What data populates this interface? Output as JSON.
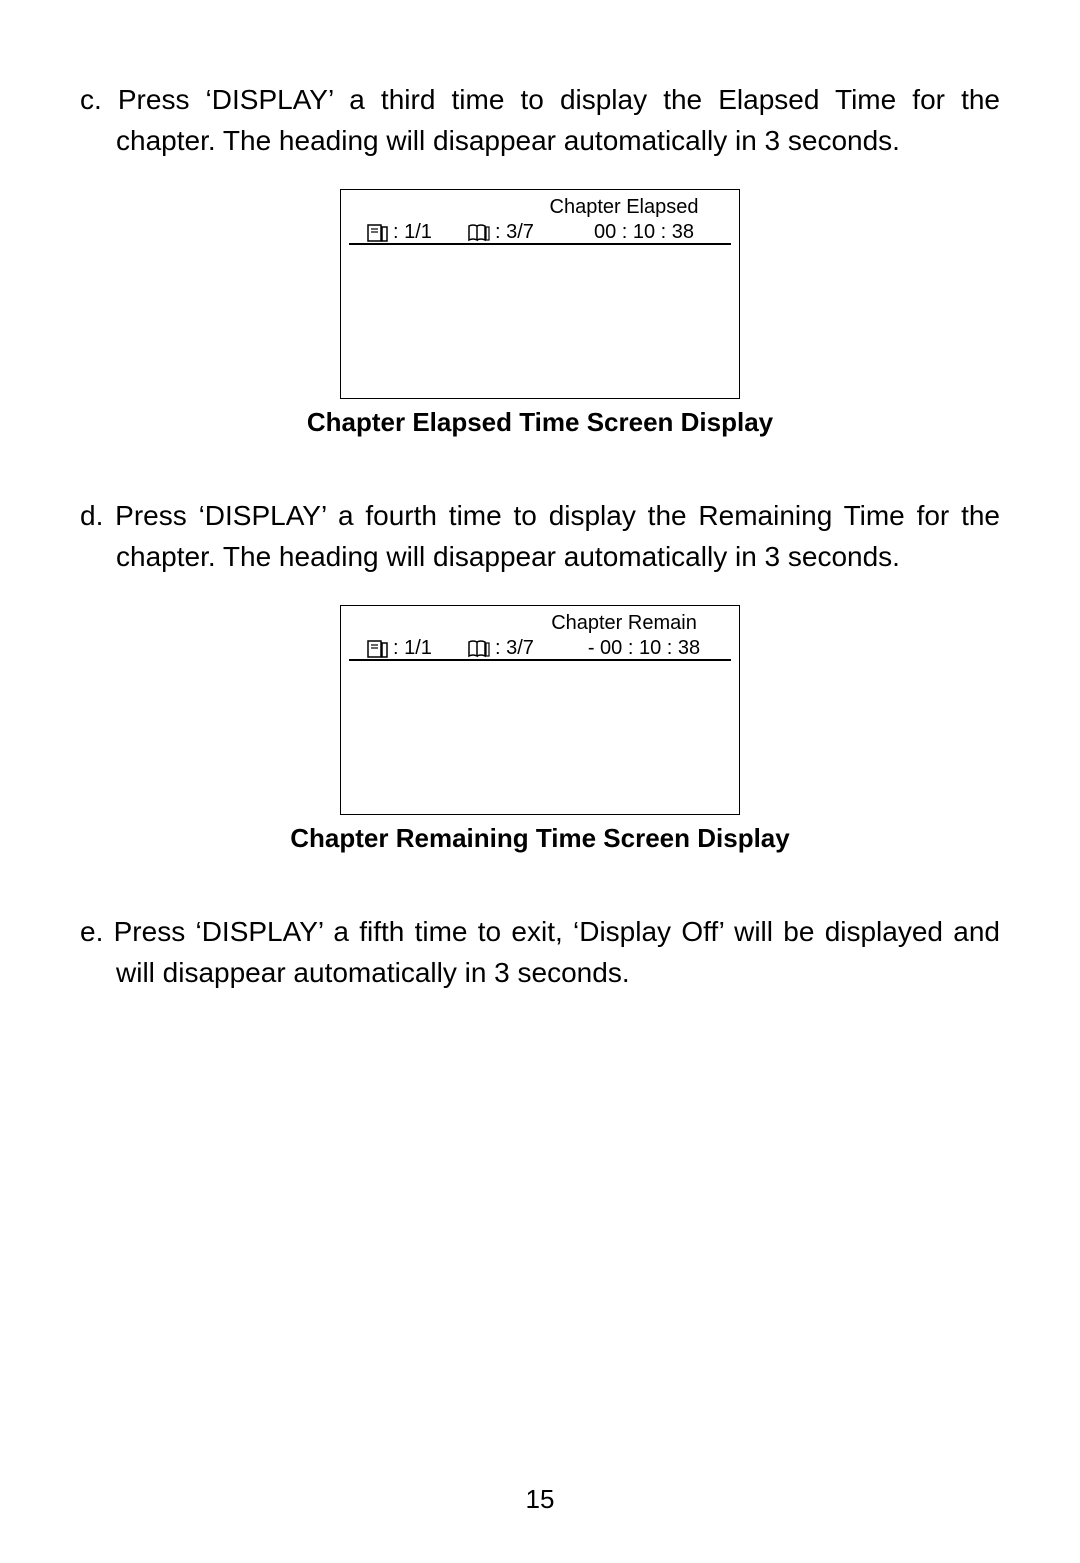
{
  "paragraph_c": "c. Press ‘DISPLAY’ a third time to display the Elapsed Time for the chapter. The heading will disappear automatically in 3 seconds.",
  "box1": {
    "header": "Chapter  Elapsed",
    "title_value": ": 1/1",
    "chapter_value": ": 3/7",
    "time_value": "00 : 10 : 38"
  },
  "caption1": "Chapter Elapsed Time Screen Display",
  "paragraph_d": "d. Press ‘DISPLAY’ a fourth time to display the Remaining Time for the chapter. The heading will disappear automatically in 3 seconds.",
  "box2": {
    "header": "Chapter  Remain",
    "title_value": ": 1/1",
    "chapter_value": ": 3/7",
    "time_value": "- 00 : 10 : 38"
  },
  "caption2": "Chapter Remaining Time Screen Display",
  "paragraph_e": "e. Press ‘DISPLAY’ a fifth time to exit, ‘Display Off’ will be displayed and will disappear automatically in 3 seconds.",
  "page_number": "15"
}
